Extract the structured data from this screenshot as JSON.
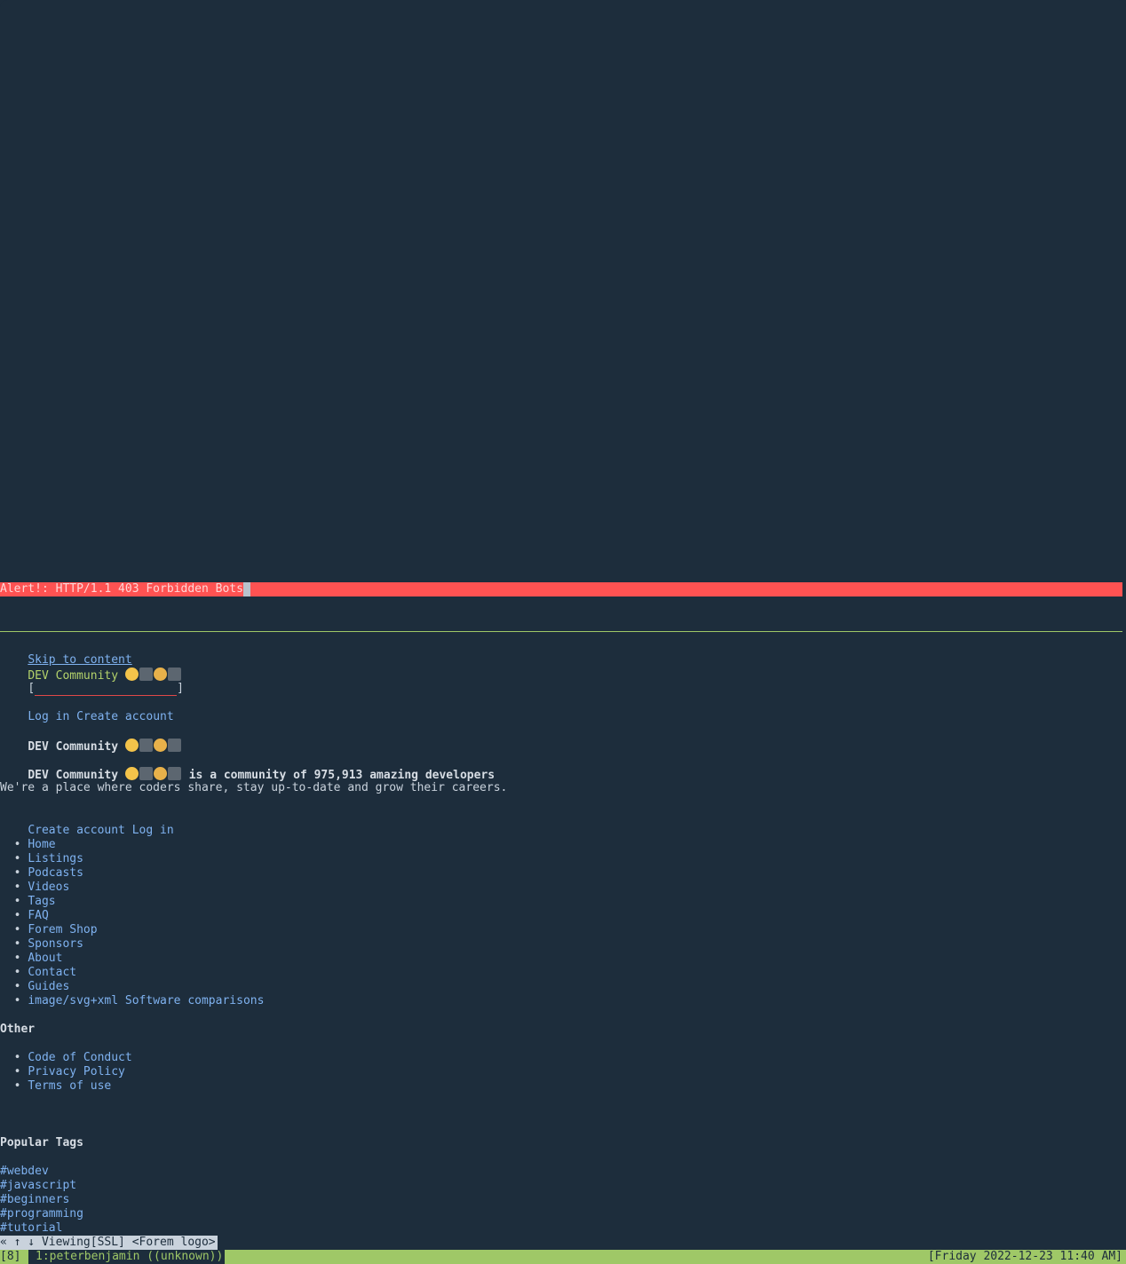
{
  "alert": {
    "text": "Alert!: HTTP/1.1 403 Forbidden Bots"
  },
  "header": {
    "skip_link": "Skip to content",
    "site_name": "DEV Community",
    "search": {
      "open": "[",
      "close": "]"
    },
    "login": "Log in",
    "create": "Create account"
  },
  "hero": {
    "heading": "DEV Community",
    "community_name": "DEV Community",
    "tagline_rest": "is a community of 975,913 amazing developers",
    "description": "We're a place where coders share, stay up-to-date and grow their careers.",
    "create": "Create account",
    "login": "Log in"
  },
  "nav": {
    "bullet": "•",
    "items": [
      "Home",
      "Listings",
      "Podcasts",
      "Videos",
      "Tags",
      "FAQ",
      "Forem Shop",
      "Sponsors",
      "About",
      "Contact",
      "Guides",
      "image/svg+xml Software comparisons"
    ]
  },
  "other": {
    "heading": "Other",
    "items": [
      "Code of Conduct",
      "Privacy Policy",
      "Terms of use"
    ]
  },
  "popular_tags": {
    "heading": "Popular Tags",
    "items": [
      "#webdev",
      "#javascript",
      "#beginners",
      "#programming",
      "#tutorial"
    ]
  },
  "lynx_status": {
    "text": "« ↑ ↓ Viewing[SSL] <Forem logo>"
  },
  "tmux": {
    "session": "[8]",
    "window": "1:peterbenjamin ((unknown))",
    "clock": "[Friday 2022-12-23 11:40 AM]"
  },
  "colors": {
    "background": "#1d2d3c",
    "alert": "#ff5252",
    "link": "#7fb2f0",
    "accent_green": "#9fc867"
  },
  "icons": {
    "emoji_sequence": [
      "woman-technologist-icon",
      "man-technologist-icon"
    ]
  }
}
